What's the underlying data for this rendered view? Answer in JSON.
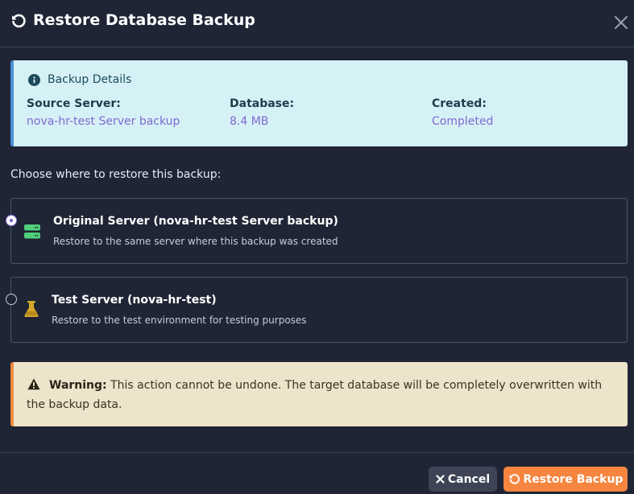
{
  "dialog": {
    "title": "Restore Database Backup",
    "title_icon": "restore-icon",
    "close_icon": "close-icon"
  },
  "details": {
    "heading": "Backup Details",
    "icon": "info-icon",
    "fields": [
      {
        "label": "Source Server:",
        "value": "nova-hr-test Server backup"
      },
      {
        "label": "Database:",
        "value": "8.4 MB"
      },
      {
        "label": "Created:",
        "value": "Completed"
      }
    ]
  },
  "choose_label": "Choose where to restore this backup:",
  "options": [
    {
      "title": "Original Server (nova-hr-test Server backup)",
      "description": "Restore to the same server where this backup was created",
      "icon": "server-icon",
      "selected": true
    },
    {
      "title": "Test Server (nova-hr-test)",
      "description": "Restore to the test environment for testing purposes",
      "icon": "flask-icon",
      "selected": false
    }
  ],
  "warning": {
    "icon": "warning-icon",
    "label": "Warning:",
    "text": " This action cannot be undone. The target database will be completely overwritten with the backup data."
  },
  "footer": {
    "cancel_label": "Cancel",
    "restore_label": "Restore Backup"
  },
  "colors": {
    "background": "#1f2535",
    "details_bg": "#d6f1f6",
    "details_accent": "#4a90d9",
    "value_color": "#7f69cf",
    "warning_bg": "#ede4cc",
    "warning_accent": "#f08a3e",
    "primary_button": "#f5853f",
    "selected_radio": "#8a74e0"
  }
}
